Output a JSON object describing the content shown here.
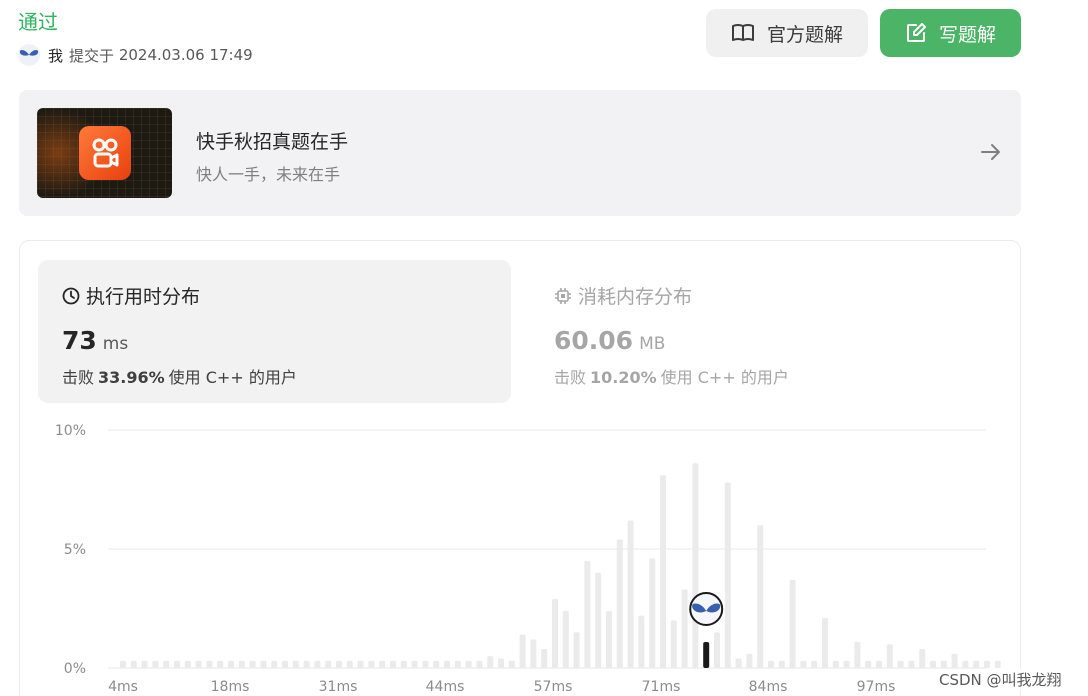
{
  "header": {
    "status": "通过",
    "user": "我",
    "submitted_prefix": "提交于",
    "submitted_time": "2024.03.06 17:49",
    "official_solution_label": "官方题解",
    "write_solution_label": "写题解"
  },
  "banner": {
    "title": "快手秋招真题在手",
    "subtitle": "快人一手，未来在手"
  },
  "runtime_tab": {
    "title": "执行用时分布",
    "value": "73",
    "unit": "ms",
    "beat_prefix": "击败",
    "beat_percent": "33.96%",
    "beat_suffix": "使用 C++ 的用户"
  },
  "memory_tab": {
    "title": "消耗内存分布",
    "value": "60.06",
    "unit": "MB",
    "beat_prefix": "击败",
    "beat_percent": "10.20%",
    "beat_suffix": "使用 C++ 的用户"
  },
  "colors": {
    "accepted_green": "#2db55d",
    "write_button_green": "#4cb466",
    "bar_gray": "#ebebeb",
    "highlight_bar": "#1a1a1a"
  },
  "chart_data": {
    "type": "bar",
    "title": "",
    "xlabel": "",
    "ylabel": "",
    "ylim": [
      0,
      10
    ],
    "y_ticks": [
      "0%",
      "5%",
      "10%"
    ],
    "x_tick_labels": [
      "4ms",
      "18ms",
      "31ms",
      "44ms",
      "57ms",
      "71ms",
      "84ms",
      "97ms"
    ],
    "grid": true,
    "highlight_index": 54,
    "highlight_label": "73 ms",
    "values": [
      0.3,
      0.3,
      0.3,
      0.3,
      0.3,
      0.3,
      0.3,
      0.3,
      0.3,
      0.3,
      0.3,
      0.3,
      0.3,
      0.3,
      0.3,
      0.3,
      0.3,
      0.3,
      0.3,
      0.3,
      0.3,
      0.3,
      0.3,
      0.3,
      0.3,
      0.3,
      0.3,
      0.3,
      0.3,
      0.3,
      0.3,
      0.3,
      0.3,
      0.3,
      0.5,
      0.4,
      0.3,
      1.4,
      1.2,
      0.8,
      2.9,
      2.4,
      1.5,
      4.5,
      4.0,
      2.4,
      5.4,
      6.2,
      2.2,
      4.6,
      8.1,
      2.0,
      3.3,
      8.6,
      1.0,
      1.5,
      7.8,
      0.4,
      0.6,
      6.0,
      0.3,
      0.3,
      3.7,
      0.3,
      0.3,
      2.1,
      0.3,
      0.3,
      1.1,
      0.3,
      0.3,
      1.0,
      0.3,
      0.3,
      0.8,
      0.3,
      0.3,
      0.6,
      0.3,
      0.3,
      0.3,
      0.3
    ]
  },
  "watermark": "CSDN @叫我龙翔"
}
